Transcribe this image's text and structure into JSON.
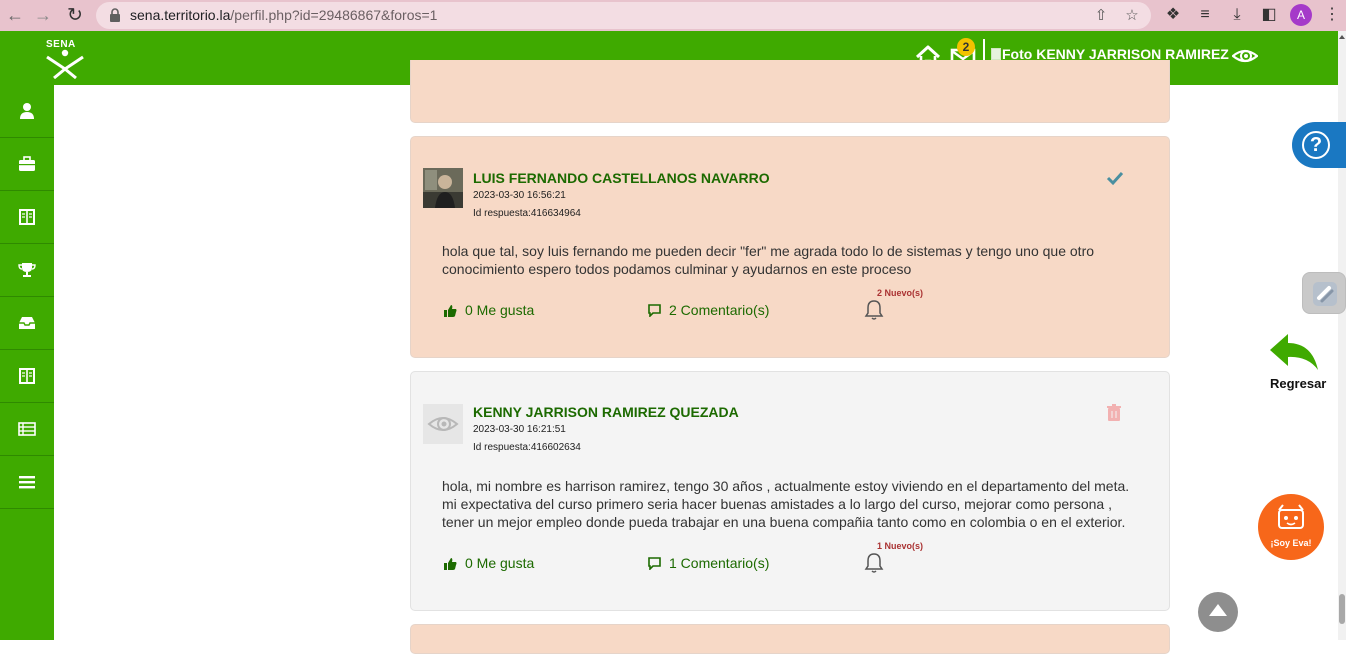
{
  "browser": {
    "url_host": "sena.territorio.la",
    "url_path": "/perfil.php?id=29486867&foros=1",
    "profile_initial": "A"
  },
  "header": {
    "logo_text": "SENA",
    "mail_count": "2",
    "user_photo_alt": "Foto KENNY JARRISON RAMIREZ"
  },
  "posts": [
    {
      "author": "LUIS FERNANDO CASTELLANOS NAVARRO",
      "date": "2023-03-30 16:56:21",
      "reply_id": "Id respuesta:416634964",
      "body": "hola que tal, soy luis fernando me pueden decir \"fer\" me agrada todo lo de sistemas y tengo uno que otro conocimiento espero todos podamos culminar y ayudarnos en este proceso",
      "likes": "0 Me gusta",
      "comments": "2 Comentario(s)",
      "new_badge": "2 Nuevo(s)"
    },
    {
      "author": "KENNY JARRISON RAMIREZ QUEZADA",
      "date": "2023-03-30 16:21:51",
      "reply_id": "Id respuesta:416602634",
      "body": "hola, mi nombre es harrison ramirez, tengo 30 años , actualmente estoy viviendo en el departamento del meta. mi expectativa del curso primero seria hacer buenas amistades a lo largo del curso, mejorar como persona , tener un mejor empleo donde pueda trabajar en una buena compañia tanto como en colombia o en el exterior.",
      "likes": "0 Me gusta",
      "comments": "1 Comentario(s)",
      "new_badge": "1 Nuevo(s)"
    }
  ],
  "widgets": {
    "help_symbol": "?",
    "back_label": "Regresar",
    "eva_label": "¡Soy Eva!"
  },
  "icons": {
    "sidebar": [
      "user-icon",
      "briefcase-icon",
      "book-icon",
      "trophy-icon",
      "inbox-icon",
      "book-icon",
      "list-icon",
      "menu-icon"
    ],
    "post_one_corner": "check-icon",
    "post_two_corner": "trash-icon"
  },
  "colors": {
    "brand_green": "#3faa00",
    "post_peach": "#f7d9c6",
    "post_grey": "#f4f4f4",
    "author_green": "#1c6a00",
    "help_blue": "#1a78c2",
    "eva_orange": "#f7671a"
  }
}
